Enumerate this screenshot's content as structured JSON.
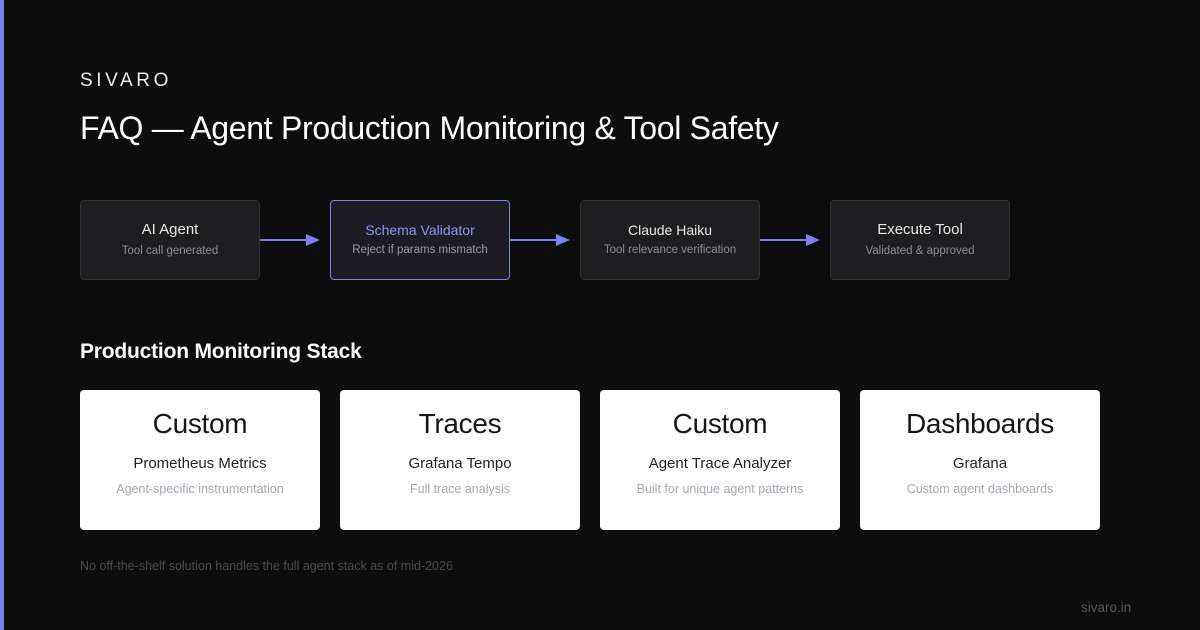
{
  "brand": "SIVARO",
  "title": "FAQ — Agent Production Monitoring & Tool Safety",
  "colors": {
    "accent": "#7b7ff0",
    "background": "#0d0d0d",
    "node_bg": "#1e1e20",
    "card_bg": "#ffffff"
  },
  "flow": {
    "nodes": [
      {
        "title": "AI Agent",
        "subtitle": "Tool call generated"
      },
      {
        "title": "Schema Validator",
        "subtitle": "Reject if params mismatch",
        "highlighted": true
      },
      {
        "title": "Claude Haiku",
        "subtitle": "Tool relevance verification"
      },
      {
        "title": "Execute Tool",
        "subtitle": "Validated & approved"
      }
    ]
  },
  "stack": {
    "heading": "Production Monitoring Stack",
    "cards": [
      {
        "headline": "Custom",
        "name": "Prometheus Metrics",
        "description": "Agent-specific instrumentation"
      },
      {
        "headline": "Traces",
        "name": "Grafana Tempo",
        "description": "Full trace analysis"
      },
      {
        "headline": "Custom",
        "name": "Agent Trace Analyzer",
        "description": "Built for unique agent patterns"
      },
      {
        "headline": "Dashboards",
        "name": "Grafana",
        "description": "Custom agent dashboards"
      }
    ]
  },
  "footnote": "No off-the-shelf solution handles the full agent stack as of mid-2026",
  "site": "sivaro.in"
}
